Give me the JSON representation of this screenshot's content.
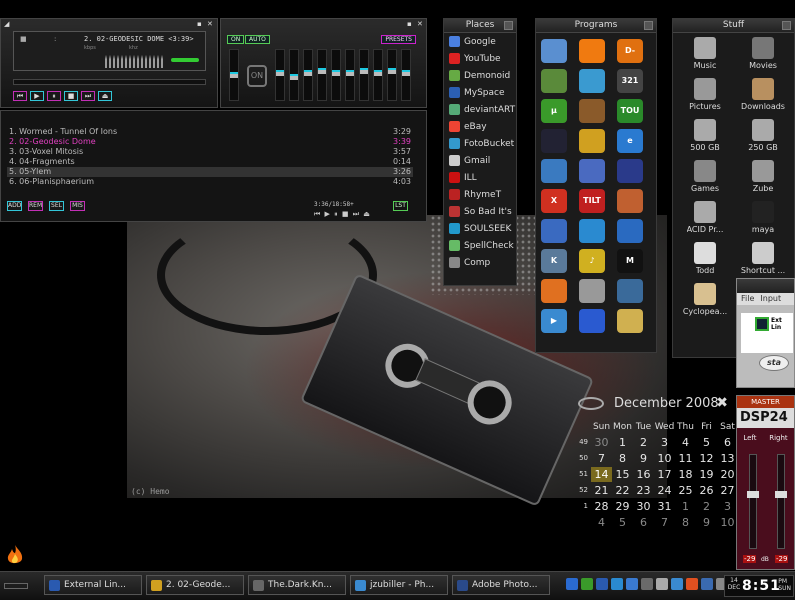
{
  "player": {
    "track_display": "2. 02-GEODESIC DOME <3:39>",
    "stereo_kbps": "kbps",
    "stereo_khz": "khz"
  },
  "equalizer": {
    "on_label": "ON",
    "auto_label": "AUTO",
    "preset_label": "PRESETS",
    "logo_text": "ON",
    "bands": [
      0.45,
      0.55,
      0.45,
      0.4,
      0.45,
      0.45,
      0.4,
      0.45,
      0.4,
      0.45
    ]
  },
  "playlist": {
    "items": [
      {
        "title": "1. Wormed - Tunnel Of Ions",
        "duration": "3:29"
      },
      {
        "title": "2. 02-Geodesic Dome",
        "duration": "3:39"
      },
      {
        "title": "3. 03-Voxel Mitosis",
        "duration": "3:57"
      },
      {
        "title": "4. 04-Fragments",
        "duration": "0:14"
      },
      {
        "title": "5. 05-Ylem",
        "duration": "3:26"
      },
      {
        "title": "6. 06-Planisphaerium",
        "duration": "4:03"
      }
    ],
    "info": "3:36/18:58+",
    "buttons": [
      "ADD",
      "REM",
      "SEL",
      "MIS"
    ],
    "list_label": "LST"
  },
  "places": {
    "title": "Places",
    "items": [
      {
        "label": "Google",
        "color": "#4a7fe0"
      },
      {
        "label": "YouTube",
        "color": "#d22"
      },
      {
        "label": "Demonoid",
        "color": "#6a4"
      },
      {
        "label": "MySpace",
        "color": "#2b5fb3"
      },
      {
        "label": "deviantART",
        "color": "#5a7"
      },
      {
        "label": "eBay",
        "color": "#e43"
      },
      {
        "label": "FotoBucket",
        "color": "#39c"
      },
      {
        "label": "Gmail",
        "color": "#ccc"
      },
      {
        "label": "ILL",
        "color": "#c11"
      },
      {
        "label": "RhymeT",
        "color": "#b22"
      },
      {
        "label": "So Bad It's",
        "color": "#b33"
      },
      {
        "label": "SOULSEEK",
        "color": "#29c"
      },
      {
        "label": "SpellCheck",
        "color": "#6b6"
      },
      {
        "label": "Comp",
        "color": "#888"
      }
    ]
  },
  "programs": {
    "title": "Programs",
    "items": [
      {
        "icon": "notepad-icon",
        "text": "",
        "color": "#5a8fd0"
      },
      {
        "icon": "firefox-flame-icon",
        "text": "",
        "color": "#f07a10"
      },
      {
        "icon": "dlink-icon",
        "text": "D-LINK",
        "color": "#e07010"
      },
      {
        "icon": "terminal-icon",
        "text": "",
        "color": "#5a8a3a"
      },
      {
        "icon": "windows-icon",
        "text": "",
        "color": "#3a9ad0"
      },
      {
        "icon": "calendar-321-icon",
        "text": "321",
        "color": "#444"
      },
      {
        "icon": "utorrent-icon",
        "text": "µ",
        "color": "#3a9a2a"
      },
      {
        "icon": "dog-icon",
        "text": "",
        "color": "#8a5a2a"
      },
      {
        "icon": "tou-icon",
        "text": "TOU",
        "color": "#2a8a2a"
      },
      {
        "icon": "darth-vader-icon",
        "text": "",
        "color": "#223"
      },
      {
        "icon": "winamp-icon",
        "text": "",
        "color": "#d0a020"
      },
      {
        "icon": "internet-explorer-icon",
        "text": "e",
        "color": "#2a7ad0"
      },
      {
        "icon": "book-icon",
        "text": "",
        "color": "#3a7ac0"
      },
      {
        "icon": "globe-icon",
        "text": "",
        "color": "#4a6ac0"
      },
      {
        "icon": "circuit-icon",
        "text": "",
        "color": "#2a3a8a"
      },
      {
        "icon": "x-mark-icon",
        "text": "X",
        "color": "#d03020"
      },
      {
        "icon": "full-tilt-icon",
        "text": "TILT",
        "color": "#c02020"
      },
      {
        "icon": "ninja-icon",
        "text": "",
        "color": "#c06030"
      },
      {
        "icon": "lightning-icon",
        "text": "",
        "color": "#3a6ac0"
      },
      {
        "icon": "blue-orb-icon",
        "text": "",
        "color": "#2a8ad0"
      },
      {
        "icon": "move-icon",
        "text": "",
        "color": "#2a6ac0"
      },
      {
        "icon": "k-icon",
        "text": "K",
        "color": "#5a7a9a"
      },
      {
        "icon": "music-note-icon",
        "text": "♪",
        "color": "#d0b020"
      },
      {
        "icon": "maya-icon",
        "text": "M",
        "color": "#111"
      },
      {
        "icon": "firefox-icon",
        "text": "",
        "color": "#e07020"
      },
      {
        "icon": "blender-icon",
        "text": "",
        "color": "#999"
      },
      {
        "icon": "crossfire-icon",
        "text": "",
        "color": "#3a6a9a"
      },
      {
        "icon": "play-icon",
        "text": "▶",
        "color": "#3a8ad0"
      },
      {
        "icon": "bird-icon",
        "text": "",
        "color": "#2a5ad0"
      },
      {
        "icon": "folder-icon",
        "text": "",
        "color": "#d0b050"
      }
    ]
  },
  "stuff": {
    "title": "Stuff",
    "items": [
      {
        "label": "Music",
        "icon": "microphone-icon",
        "color": "#aaa"
      },
      {
        "label": "Movies",
        "icon": "film-icon",
        "color": "#777"
      },
      {
        "label": "Pictures",
        "icon": "camera-icon",
        "color": "#999"
      },
      {
        "label": "Downloads",
        "icon": "downloads-icon",
        "color": "#b89060"
      },
      {
        "label": "500 GB",
        "icon": "drive-icon",
        "color": "#aaa"
      },
      {
        "label": "250 GB",
        "icon": "drive-icon",
        "color": "#aaa"
      },
      {
        "label": "Games",
        "icon": "joystick-icon",
        "color": "#888"
      },
      {
        "label": "Zube",
        "icon": "figure-icon",
        "color": "#999"
      },
      {
        "label": "ACID Pr...",
        "icon": "gamepad-icon",
        "color": "#aaa"
      },
      {
        "label": "maya",
        "icon": "maya-icon",
        "color": "#222"
      },
      {
        "label": "Todd",
        "icon": "smiley-icon",
        "color": "#ddd"
      },
      {
        "label": "Shortcut ...",
        "icon": "scanner-icon",
        "color": "#ccc"
      },
      {
        "label": "Cyclopea...",
        "icon": "folder-icon",
        "color": "#d8c090"
      }
    ]
  },
  "miniwin": {
    "menu": [
      "File",
      "Input"
    ],
    "chip_text": "Ext Lin",
    "logo": "sta"
  },
  "mixer": {
    "header": "MASTER",
    "name": "DSP24",
    "left_label": "Left",
    "right_label": "Right",
    "left_db": "-29",
    "right_db": "-29",
    "db_unit": "dB"
  },
  "calendar": {
    "month": "December 2008",
    "close": "✖",
    "headers": [
      "Sun",
      "Mon",
      "Tue",
      "Wed",
      "Thu",
      "Fri",
      "Sat"
    ],
    "weeks": [
      {
        "wk": "49",
        "days": [
          "30",
          "1",
          "2",
          "3",
          "4",
          "5",
          "6"
        ]
      },
      {
        "wk": "50",
        "days": [
          "7",
          "8",
          "9",
          "10",
          "11",
          "12",
          "13"
        ]
      },
      {
        "wk": "51",
        "days": [
          "14",
          "15",
          "16",
          "17",
          "18",
          "19",
          "20"
        ]
      },
      {
        "wk": "52",
        "days": [
          "21",
          "22",
          "23",
          "24",
          "25",
          "26",
          "27"
        ]
      },
      {
        "wk": "1",
        "days": [
          "28",
          "29",
          "30",
          "31",
          "1",
          "2",
          "3"
        ]
      },
      {
        "wk": "",
        "days": [
          "4",
          "5",
          "6",
          "7",
          "8",
          "9",
          "10"
        ]
      }
    ],
    "today": "14"
  },
  "wallpaper": {
    "caption": "(c) Hemo"
  },
  "taskbar": {
    "tasks": [
      {
        "label": "External Lin...",
        "color": "#2a5ab0"
      },
      {
        "label": "2. 02-Geode...",
        "color": "#d0a020"
      },
      {
        "label": "The.Dark.Kn...",
        "color": "#666"
      },
      {
        "label": "jzubiller - Ph...",
        "color": "#3a8ad0"
      },
      {
        "label": "Adobe Photo...",
        "color": "#2a4a8a"
      }
    ],
    "tray": [
      "#2a6ad0",
      "#3a9a2a",
      "#2a5ab0",
      "#2a8ad0",
      "#3a7ad0",
      "#6a6a6a",
      "#aaa",
      "#3a8ad0",
      "#e05020",
      "#3a6ab0",
      "#888",
      "#c03030"
    ],
    "clock": {
      "day": "14",
      "mon": "DEC",
      "time": "8:51",
      "ampm": "PM",
      "weekday": "SUN"
    }
  }
}
